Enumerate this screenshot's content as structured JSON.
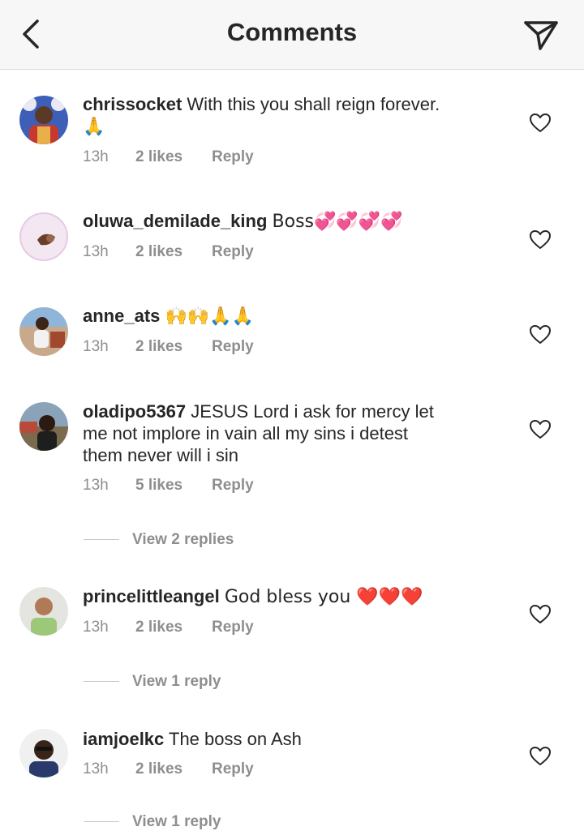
{
  "header": {
    "title": "Comments",
    "back_icon": "chevron-left-icon",
    "send_icon": "paper-plane-icon"
  },
  "comments": [
    {
      "username": "chrissocket",
      "text": "With this you shall reign forever.",
      "text2": "🙏",
      "time": "13h",
      "likes": "2 likes",
      "reply": "Reply"
    },
    {
      "username": "oluwa_demilade_king",
      "text": "Boss💞💞💞💞",
      "time": "13h",
      "likes": "2 likes",
      "reply": "Reply"
    },
    {
      "username": "anne_ats",
      "text": "🙌🙌🙏🙏",
      "time": "13h",
      "likes": "2 likes",
      "reply": "Reply"
    },
    {
      "username": "oladipo5367",
      "text": "JESUS Lord i ask for mercy let",
      "text2": "me  not implore in vain all my sins i detest",
      "text3": "them never will i sin",
      "time": "13h",
      "likes": "5 likes",
      "reply": "Reply",
      "view_replies": "View 2 replies"
    },
    {
      "username": "princelittleangel",
      "text": "God bless you ❤️❤️❤️",
      "time": "13h",
      "likes": "2 likes",
      "reply": "Reply",
      "view_replies": "View 1 reply"
    },
    {
      "username": "iamjoelkc",
      "text": "The boss on Ash",
      "time": "13h",
      "likes": "2 likes",
      "reply": "Reply",
      "view_replies": "View 1 reply"
    }
  ],
  "colors": {
    "text": "#262626",
    "muted": "#8e8e8e",
    "header_bg": "#f7f7f7"
  }
}
